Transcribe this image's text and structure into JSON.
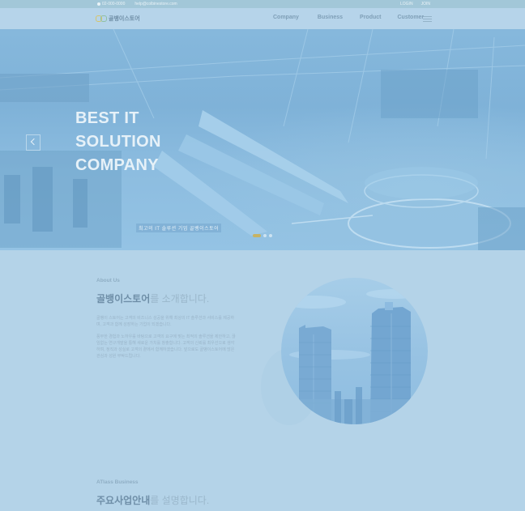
{
  "topbar": {
    "left_items": [
      "02-000-0000",
      "help@colbinestore.com"
    ],
    "right_items": [
      "LOGIN",
      "JOIN"
    ]
  },
  "header": {
    "logo_text": "골뱅이스토어",
    "nav": [
      "Company",
      "Business",
      "Product",
      "Customer"
    ]
  },
  "hero": {
    "title_lines": [
      "BEST IT",
      "SOLUTION",
      "COMPANY"
    ],
    "caption": "최고의 IT 솔루션 기업 골뱅이스토어",
    "slide_count": 3,
    "active_slide": 1
  },
  "about": {
    "label": "About Us",
    "title_strong": "골뱅이스토어",
    "title_rest": "를 소개합니다.",
    "paragraph1": "골뱅이 스토어는 고객의 비즈니스 성공을 위해 최상의 IT 솔루션과 서비스를 제공하며, 고객과 함께 성장하는 기업이 되겠습니다.",
    "paragraph2": "풍부한 경험과 노하우를 바탕으로 고객의 요구에 맞는 최적의 솔루션을 제안하고, 끊임없는 연구개발을 통해 새로운 가치를 창출합니다. 고객의 신뢰를 최우선으로 생각하며, 정직과 성실로 고객의 곁에서 함께하겠습니다. 앞으로도 골뱅이스토어에 많은 관심과 성원 부탁드립니다."
  },
  "business": {
    "label": "ATlass Business",
    "title_strong": "주요사업안내",
    "title_rest": "를 설명합니다."
  },
  "colors": {
    "overlay": "#b4d3e8",
    "hero_bg": "#86b8dc",
    "active_dot": "#c7b364"
  }
}
